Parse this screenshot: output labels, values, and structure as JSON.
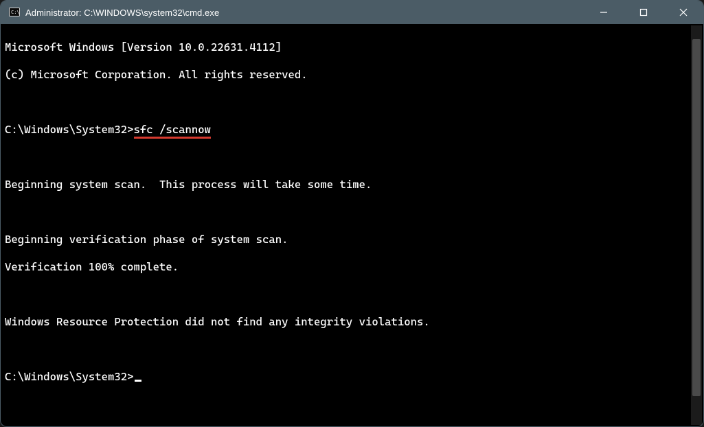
{
  "window": {
    "title": "Administrator: C:\\WINDOWS\\system32\\cmd.exe"
  },
  "terminal": {
    "banner_version": "Microsoft Windows [Version 10.0.22631.4112]",
    "banner_copyright": "(c) Microsoft Corporation. All rights reserved.",
    "prompt1_path": "C:\\Windows\\System32>",
    "prompt1_cmd": "sfc /scannow",
    "scan_begin": "Beginning system scan.  This process will take some time.",
    "verify_begin": "Beginning verification phase of system scan.",
    "verify_done": "Verification 100% complete.",
    "result": "Windows Resource Protection did not find any integrity violations.",
    "prompt2_path": "C:\\Windows\\System32>"
  }
}
